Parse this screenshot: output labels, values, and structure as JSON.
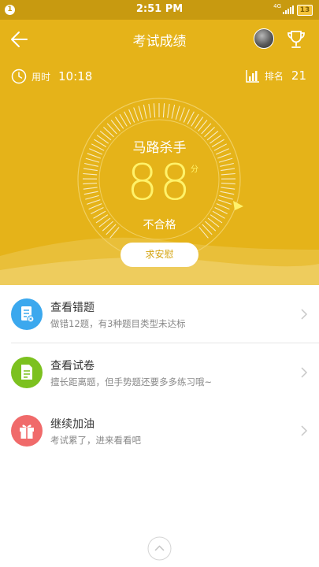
{
  "status_bar": {
    "notification_count": "1",
    "time": "2:51 PM",
    "network": "4G",
    "battery": "13"
  },
  "header": {
    "title": "考试成绩",
    "time_label": "用时",
    "time_value": "10:18",
    "rank_label": "排名",
    "rank_value": "21"
  },
  "result": {
    "nickname": "马路杀手",
    "score": "88",
    "score_unit": "分",
    "verdict": "不合格",
    "comfort_button": "求安慰"
  },
  "list": [
    {
      "title": "查看错题",
      "subtitle": "做错12题，有3种题目类型未达标",
      "icon": "wrong-questions-icon",
      "color": "#3ba8ee"
    },
    {
      "title": "查看试卷",
      "subtitle": "擅长距离题，但手势题还要多多练习哦~",
      "icon": "exam-paper-icon",
      "color": "#7cc11f"
    },
    {
      "title": "继续加油",
      "subtitle": "考试累了，进来看看吧",
      "icon": "gift-icon",
      "color": "#f06a6a"
    }
  ],
  "colors": {
    "header_bg": "#e5b319",
    "score": "#fff26a",
    "button_text": "#d4a30e"
  }
}
